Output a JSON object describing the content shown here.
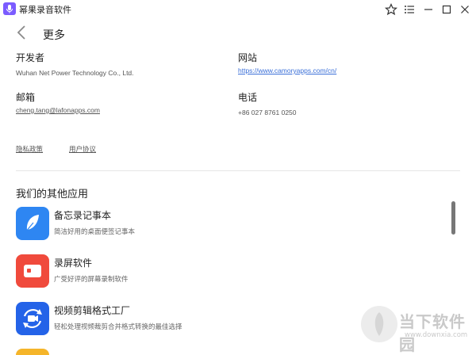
{
  "window": {
    "title": "幂果录音软件"
  },
  "header": {
    "title": "更多"
  },
  "contact": {
    "developer": {
      "label": "开发者",
      "value": "Wuhan Net Power Technology Co., Ltd."
    },
    "website": {
      "label": "网站",
      "value": "https://www.camoryapps.com/cn/"
    },
    "email": {
      "label": "邮箱",
      "value": "cheng.tang@lafonapps.com"
    },
    "phone": {
      "label": "电话",
      "value": "+86 027 8761 0250"
    }
  },
  "links": {
    "privacy": "隐私政策",
    "terms": "用户协议"
  },
  "other_apps": {
    "title": "我们的其他应用",
    "items": [
      {
        "name": "备忘录记事本",
        "desc": "简洁好用的桌面便签记事本",
        "color": "#2e86f2"
      },
      {
        "name": "录屏软件",
        "desc": "广受好评的屏幕录制软件",
        "color": "#f04a3c"
      },
      {
        "name": "视频剪辑格式工厂",
        "desc": "轻松处理视频裁剪合并格式转换的最佳选择",
        "color": "#2463e8"
      }
    ]
  },
  "watermark": {
    "brand": "当下软件园",
    "url": "www.downxia.com"
  }
}
